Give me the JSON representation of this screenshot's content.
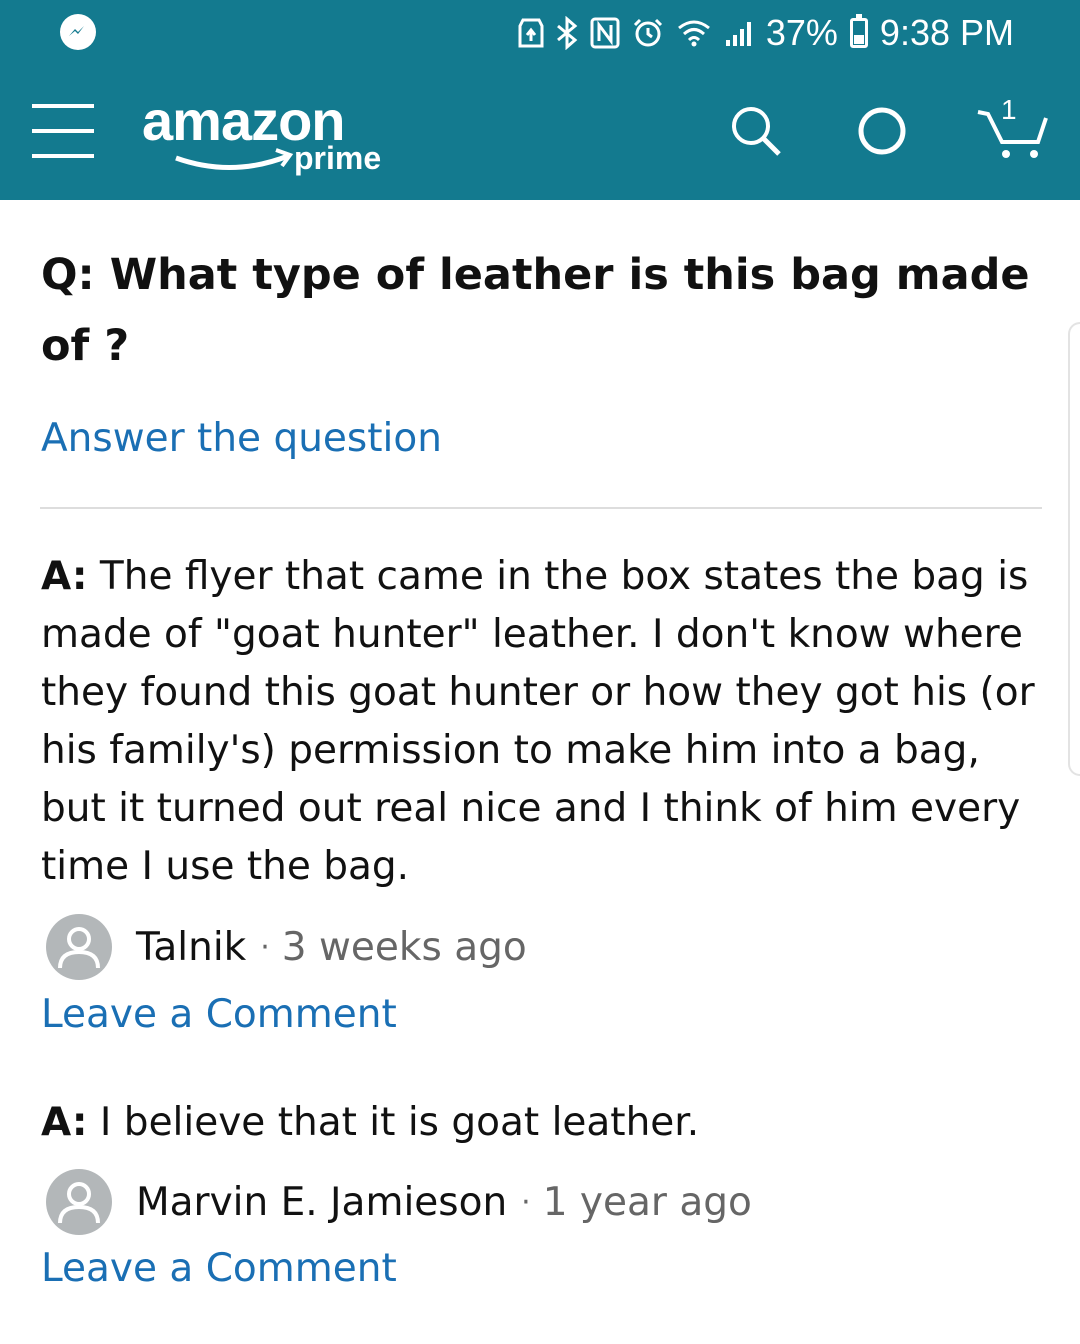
{
  "colors": {
    "header_background": "#137a8f",
    "link": "#1a6fb4",
    "avatar_background": "#b3b7b9",
    "meta_text": "#666666"
  },
  "status_bar": {
    "battery_percent": "37%",
    "battery_level": 0.37,
    "time": "9:38 PM",
    "icons": [
      "messenger-icon",
      "recycle-icon",
      "bluetooth-icon",
      "nfc-icon",
      "alarm-icon",
      "wifi-icon",
      "signal-icon",
      "battery-icon"
    ]
  },
  "header": {
    "logo_word": "amazon",
    "logo_sub": "prime",
    "menu_icon": "hamburger-menu-icon",
    "search_icon": "search-icon",
    "alexa_icon": "alexa-icon",
    "cart_icon": "cart-icon",
    "cart_count": "1"
  },
  "question": {
    "text": "Q: What type of leather is this bag made of ?",
    "answer_link": "Answer the question"
  },
  "answers": [
    {
      "prefix": "A:",
      "text": " The flyer that came in the box states the bag is made of \"goat hunter\" leather. I don't know where they found this goat hunter or how they got his (or his family's) permission to make him into a bag, but it turned out real nice and I think of him every time I use the bag.",
      "author": "Talnik",
      "separator": "·",
      "date": "3 weeks ago",
      "comment_link": "Leave a Comment"
    },
    {
      "prefix": "A:",
      "text": " I believe that it is goat leather.",
      "author": "Marvin E. Jamieson",
      "separator": "·",
      "date": "1 year ago",
      "comment_link": "Leave a Comment"
    }
  ]
}
